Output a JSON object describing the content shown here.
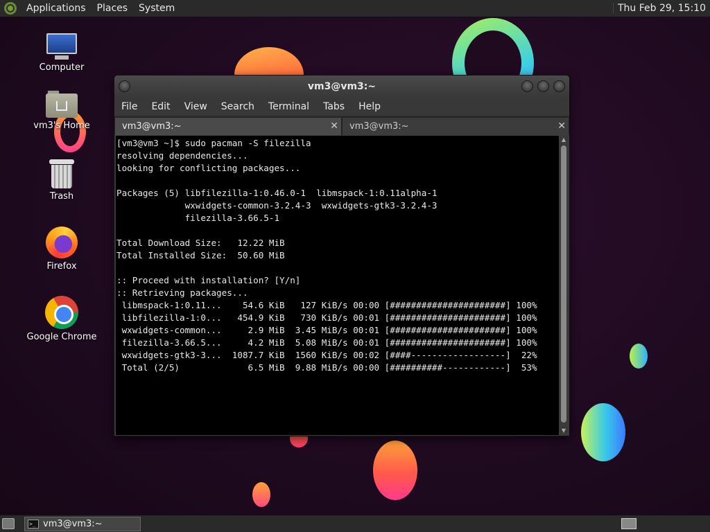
{
  "top_panel": {
    "menus": [
      "Applications",
      "Places",
      "System"
    ],
    "clock": "Thu Feb 29, 15:10"
  },
  "desktop_icons": [
    {
      "label": "Computer",
      "icon": "computer-icon"
    },
    {
      "label": "vm3's Home",
      "icon": "home-folder-icon"
    },
    {
      "label": "Trash",
      "icon": "trash-icon"
    },
    {
      "label": "Firefox",
      "icon": "firefox-icon"
    },
    {
      "label": "Google Chrome",
      "icon": "chrome-icon"
    }
  ],
  "window": {
    "title": "vm3@vm3:~",
    "menu": [
      "File",
      "Edit",
      "View",
      "Search",
      "Terminal",
      "Tabs",
      "Help"
    ],
    "tabs": [
      {
        "label": "vm3@vm3:~",
        "active": true
      },
      {
        "label": "vm3@vm3:~",
        "active": false
      }
    ],
    "terminal_lines": [
      "[vm3@vm3 ~]$ sudo pacman -S filezilla",
      "resolving dependencies...",
      "looking for conflicting packages...",
      "",
      "Packages (5) libfilezilla-1:0.46.0-1  libmspack-1:0.11alpha-1",
      "             wxwidgets-common-3.2.4-3  wxwidgets-gtk3-3.2.4-3",
      "             filezilla-3.66.5-1",
      "",
      "Total Download Size:   12.22 MiB",
      "Total Installed Size:  50.60 MiB",
      "",
      ":: Proceed with installation? [Y/n]",
      ":: Retrieving packages...",
      " libmspack-1:0.11...    54.6 KiB   127 KiB/s 00:00 [######################] 100%",
      " libfilezilla-1:0...   454.9 KiB   730 KiB/s 00:01 [######################] 100%",
      " wxwidgets-common...     2.9 MiB  3.45 MiB/s 00:01 [######################] 100%",
      " filezilla-3.66.5...     4.2 MiB  5.08 MiB/s 00:01 [######################] 100%",
      " wxwidgets-gtk3-3...  1087.7 KiB  1560 KiB/s 00:02 [####------------------]  22%",
      " Total (2/5)             6.5 MiB  9.88 MiB/s 00:00 [##########------------]  53%"
    ]
  },
  "bottom_panel": {
    "task_label": "vm3@vm3:~",
    "task_icon_text": ">_"
  }
}
